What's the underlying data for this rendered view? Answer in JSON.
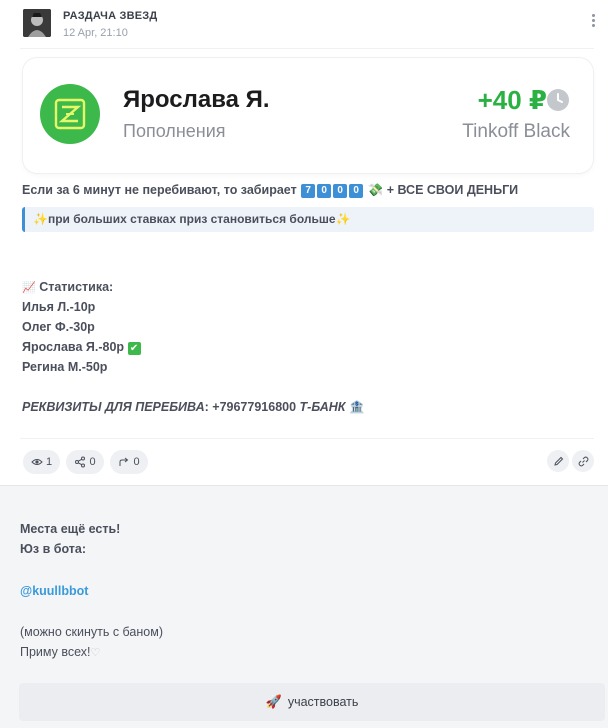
{
  "post": {
    "channel_title": "РАЗДАЧА ЗВЕЗД",
    "date": "12 Apr, 21:10",
    "card": {
      "name": "Ярослава Я.",
      "category": "Пополнения",
      "amount": "+40 ₽",
      "account": "Tinkoff Black",
      "colors": {
        "logo": "#3cb94a",
        "amount": "#2bb143"
      }
    },
    "line1_text": "Если за 6 минут не перебивают, то забирает",
    "line1_digits": [
      "7",
      "0",
      "0",
      "0"
    ],
    "line1_suffix": "+ ВСЕ СВОИ ДЕНЬГИ",
    "quote_text": "при больших ставках приз становиться больше",
    "stats_title": "Статистика:",
    "stats": [
      "Илья Л.-10р",
      "Олег Ф.-30р",
      "Ярослава Я.-80р",
      "Регина М.-50р"
    ],
    "requisites_label": "РЕКВИЗИТЫ ДЛЯ ПЕРЕБИВА",
    "requisites_phone": ": +79677916800",
    "requisites_bank": "Т-БАНК",
    "views": "1",
    "shares": "0",
    "forwards": "0"
  },
  "ad": {
    "line1": "Места ещё есть!",
    "line2": "Юз в бота:",
    "bot_link": "@kuullbbot",
    "line3": "(можно скинуть с баном)",
    "line4": "Приму всех!",
    "button_label": "участвовать"
  },
  "icons": [
    "more-icon",
    "clock-icon",
    "eye-icon",
    "share-icon",
    "forward-icon",
    "edit-icon",
    "link-icon",
    "rocket-icon"
  ]
}
